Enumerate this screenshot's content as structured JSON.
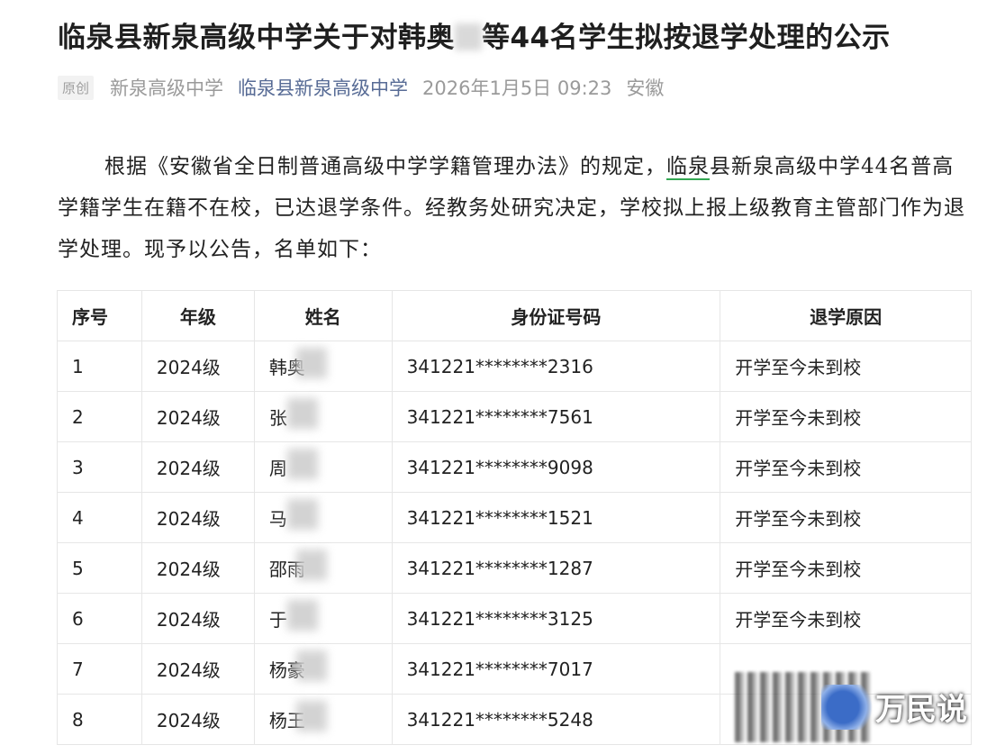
{
  "article": {
    "title_prefix": "临泉县新泉高级中学关于对韩奥",
    "title_suffix": "等44名学生拟按退学处理的公示",
    "meta": {
      "badge": "原创",
      "author": "新泉高级中学",
      "account": "临泉县新泉高级中学",
      "date": "2026年1月5日 09:23",
      "location": "安徽"
    },
    "body": {
      "part1": "根据《安徽省全日制普通高级中学学籍管理办法》的规定，",
      "highlight": "临泉",
      "part2": "县新泉高级中学44名普高学籍学生在籍不在校，已达退学条件。经教务处研究决定，学校拟上报上级教育主管部门作为退学处理。现予以公告，名单如下："
    }
  },
  "table": {
    "headers": [
      "序号",
      "年级",
      "姓名",
      "身份证号码",
      "退学原因"
    ],
    "rows": [
      {
        "no": "1",
        "grade": "2024级",
        "name": "韩奥",
        "id": "341221********2316",
        "reason": "开学至今未到校"
      },
      {
        "no": "2",
        "grade": "2024级",
        "name": "张",
        "id": "341221********7561",
        "reason": "开学至今未到校"
      },
      {
        "no": "3",
        "grade": "2024级",
        "name": "周",
        "id": "341221********9098",
        "reason": "开学至今未到校"
      },
      {
        "no": "4",
        "grade": "2024级",
        "name": "马",
        "id": "341221********1521",
        "reason": "开学至今未到校"
      },
      {
        "no": "5",
        "grade": "2024级",
        "name": "邵雨",
        "id": "341221********1287",
        "reason": "开学至今未到校"
      },
      {
        "no": "6",
        "grade": "2024级",
        "name": "于",
        "id": "341221********3125",
        "reason": "开学至今未到校"
      },
      {
        "no": "7",
        "grade": "2024级",
        "name": "杨豪",
        "id": "341221********7017",
        "reason": ""
      },
      {
        "no": "8",
        "grade": "2024级",
        "name": "杨王",
        "id": "341221********5248",
        "reason": ""
      }
    ]
  },
  "watermark": {
    "text": "万民说"
  }
}
